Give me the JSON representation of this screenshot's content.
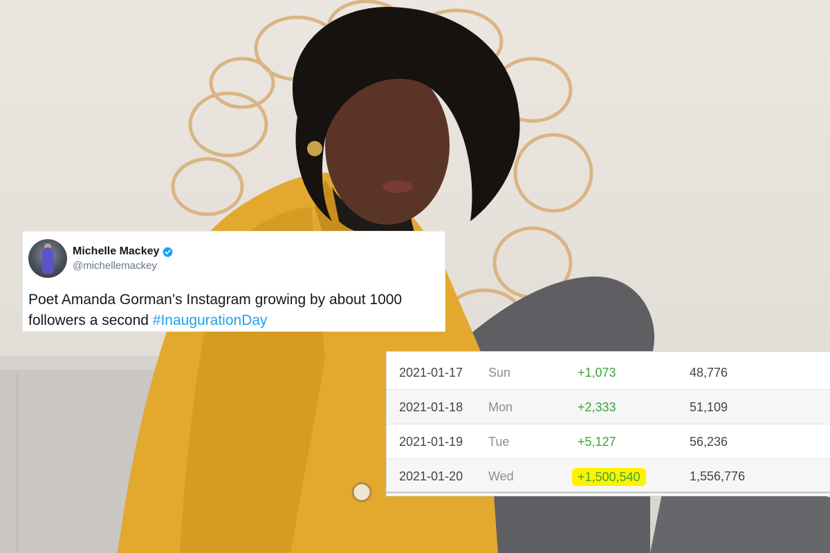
{
  "tweet": {
    "display_name": "Michelle Mackey",
    "handle": "@michellemackey",
    "text_before": "Poet Amanda Gorman’s Instagram growing by about 1000 followers a second ",
    "hashtag": "#InaugurationDay"
  },
  "stats": {
    "rows": [
      {
        "date": "2021-01-17",
        "day": "Sun",
        "gain": "+1,073",
        "total": "48,776",
        "highlighted": false
      },
      {
        "date": "2021-01-18",
        "day": "Mon",
        "gain": "+2,333",
        "total": "51,109",
        "highlighted": false
      },
      {
        "date": "2021-01-19",
        "day": "Tue",
        "gain": "+5,127",
        "total": "56,236",
        "highlighted": false
      },
      {
        "date": "2021-01-20",
        "day": "Wed",
        "gain": "+1,500,540",
        "total": "1,556,776",
        "highlighted": true
      }
    ]
  },
  "colors": {
    "gain_green": "#3aa43a",
    "highlight_yellow": "#fff200",
    "hashtag_blue": "#1da1f2",
    "verified_blue": "#1da1f2"
  }
}
